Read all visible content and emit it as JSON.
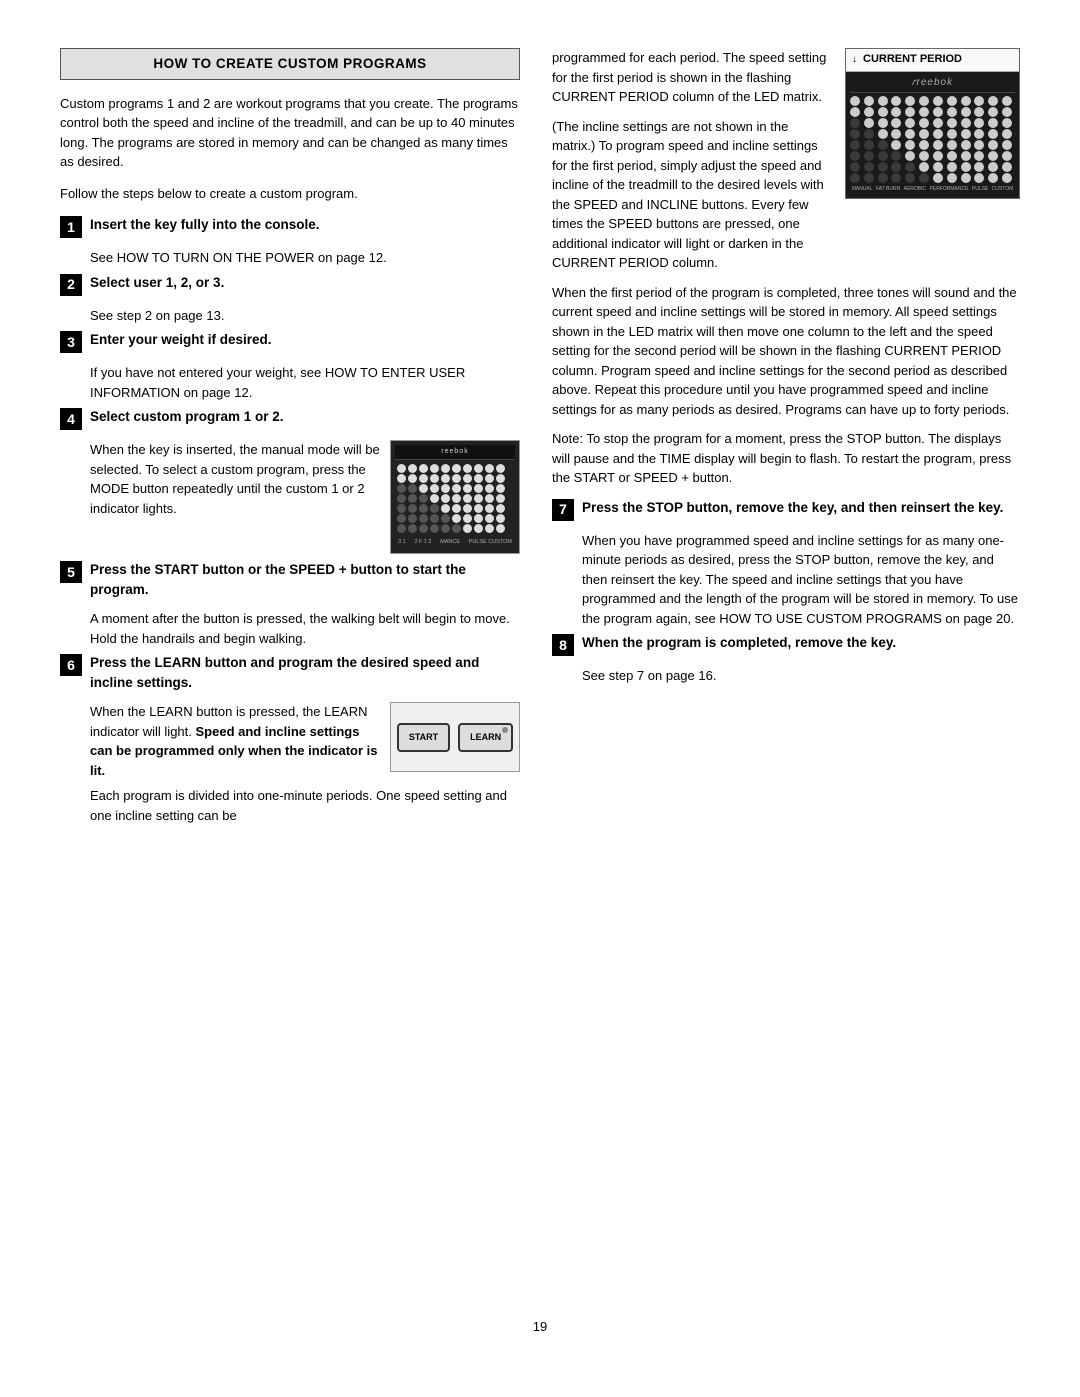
{
  "header": {
    "title": "HOW TO CREATE CUSTOM PROGRAMS"
  },
  "left": {
    "intro": [
      "Custom programs 1 and 2 are workout programs that you create. The programs control both the speed and incline of the treadmill, and can be up to 40 minutes long. The programs are stored in memory and can be changed as many times as desired.",
      "Follow the steps below to create a custom program."
    ],
    "steps": [
      {
        "number": "1",
        "title": "Insert the key fully into the console.",
        "sub": "See HOW TO TURN ON THE POWER on page 12."
      },
      {
        "number": "2",
        "title": "Select user 1, 2, or 3.",
        "sub": "See step 2 on page 13."
      },
      {
        "number": "3",
        "title": "Enter your weight if desired.",
        "sub": "If you have not entered your weight, see HOW TO ENTER USER INFORMATION on page 12."
      },
      {
        "number": "4",
        "title": "Select custom program 1 or 2.",
        "body": "When the key is inserted, the manual mode will be selected. To select a custom program, press the MODE button repeatedly until the custom 1 or 2 indicator lights."
      },
      {
        "number": "5",
        "title": "Press the START button or the SPEED + button to start the program.",
        "sub": "A moment after the button is pressed, the walking belt will begin to move. Hold the handrails and begin walking."
      },
      {
        "number": "6",
        "title": "Press the LEARN button and program the desired speed and incline settings.",
        "body_parts": [
          "When the LEARN button is pressed, the LEARN indicator will light. ",
          "Speed and incline settings can be programmed only when the indicator is lit."
        ],
        "bold_part": "Speed and incline settings can be programmed only when the indicator is lit."
      }
    ],
    "last_para": "Each program is divided into one-minute periods. One speed setting and one incline setting can be"
  },
  "right": {
    "current_period_label": "CURRENT PERIOD",
    "reebok_logo": "reebok",
    "paras": [
      "programmed for each period. The speed setting for the first period is shown in the flashing CURRENT PERIOD column of the LED matrix.",
      "(The incline settings are not shown in the matrix.) To program speed and incline settings for the first period, simply adjust the speed and incline of the treadmill to the desired levels with the SPEED and INCLINE buttons. Every few times the SPEED buttons are pressed, one additional indicator will light or darken in the CURRENT PERIOD column.",
      "When the first period of the program is completed, three tones will sound and the current speed and incline settings will be stored in memory. All speed settings shown in the LED matrix will then move one column to the left and the speed setting for the second period will be shown in the flashing CURRENT PERIOD column. Program speed and incline settings for the second period as described above. Repeat this procedure until you have programmed speed and incline settings for as many periods as desired. Programs can have up to forty periods.",
      "Note: To stop the program for a moment, press the STOP button. The displays will pause and the TIME display will begin to flash. To restart the program, press the START or SPEED + button."
    ],
    "steps": [
      {
        "number": "7",
        "title": "Press the STOP button, remove the key, and then reinsert the key.",
        "body": "When you have programmed speed and incline settings for as many one-minute periods as desired, press the STOP button, remove the key, and then reinsert the key. The speed and incline settings that you have programmed and the length of the program will be stored in memory. To use the program again, see HOW TO USE CUSTOM PROGRAMS on page 20."
      },
      {
        "number": "8",
        "title": "When the program is completed, remove the key.",
        "sub": "See step 7 on page 16."
      }
    ]
  },
  "page_number": "19"
}
